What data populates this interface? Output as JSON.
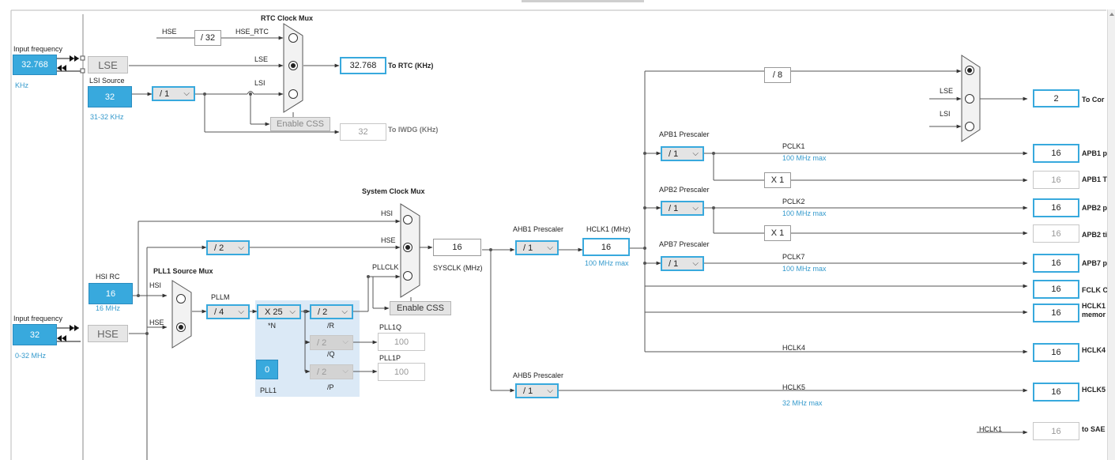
{
  "rtc": {
    "mux_title": "RTC Clock Mux",
    "input_freq_label": "Input frequency",
    "lse_freq": "32.768",
    "khz_unit": "KHz",
    "lse_label": "LSE",
    "lsi_source_label": "LSI Source",
    "lsi_value": "32",
    "lsi_range": "31-32 KHz",
    "lsi_div": "/ 1",
    "hse_label": "HSE",
    "hse_div": "/ 32",
    "hse_rtc_label": "HSE_RTC",
    "mux_lse": "LSE",
    "mux_lsi": "LSI",
    "rtc_out": "32.768",
    "rtc_out_label": "To RTC (KHz)",
    "enable_css": "Enable CSS",
    "iwdg_out": "32",
    "iwdg_label": "To IWDG (KHz)"
  },
  "hse_in": {
    "input_freq_label": "Input frequency",
    "value": "32",
    "range": "0-32 MHz",
    "box_label": "HSE"
  },
  "hsi": {
    "label": "HSI RC",
    "value": "16",
    "unit": "16 MHz"
  },
  "pll": {
    "mux_title": "PLL1 Source Mux",
    "hsi_label": "HSI",
    "hse_label": "HSE",
    "pllm_label": "PLLM",
    "pllm_value": "/ 4",
    "n_value": "X 25",
    "n_label": "*N",
    "r_value": "/ 2",
    "r_label": "/R",
    "q_value": "/ 2",
    "q_label": "/Q",
    "p_value": "/ 2",
    "p_label": "/P",
    "pll1q_label": "PLL1Q",
    "pll1q_value": "100",
    "pll1p_label": "PLL1P",
    "pll1p_value": "100",
    "pll1_label": "PLL1",
    "pll1_frac": "0"
  },
  "sysclk": {
    "mux_title": "System Clock Mux",
    "hsi_label": "HSI",
    "hse_label": "HSE",
    "pllclk_label": "PLLCLK",
    "hse_div": "/ 2",
    "value": "16",
    "label": "SYSCLK (MHz)",
    "enable_css": "Enable CSS"
  },
  "ahb": {
    "ahb1_label": "AHB1 Prescaler",
    "ahb1_value": "/ 1",
    "hclk1_label": "HCLK1 (MHz)",
    "hclk1_value": "16",
    "hclk1_max": "100 MHz max",
    "ahb5_label": "AHB5 Prescaler",
    "ahb5_value": "/ 1"
  },
  "bus": {
    "div8": "/ 8",
    "mux_lse": "LSE",
    "mux_lsi": "LSI",
    "cortex_value": "2",
    "cortex_label": "To Cor",
    "apb1_label": "APB1 Prescaler",
    "apb1_value": "/ 1",
    "pclk1_label": "PCLK1",
    "pclk1_max": "100 MHz max",
    "apb1_out": "16",
    "apb1_out_label": "APB1 p",
    "x1_a": "X 1",
    "apb1_tim": "16",
    "apb1_tim_label": "APB1 Ti",
    "apb2_label": "APB2 Prescaler",
    "apb2_value": "/ 1",
    "pclk2_label": "PCLK2",
    "pclk2_max": "100 MHz max",
    "apb2_out": "16",
    "apb2_out_label": "APB2 p",
    "x1_b": "X 1",
    "apb2_tim": "16",
    "apb2_tim_label": "APB2 ti",
    "apb7_label": "APB7 Prescaler",
    "apb7_value": "/ 1",
    "pclk7_label": "PCLK7",
    "pclk7_max": "100 MHz max",
    "apb7_out": "16",
    "apb7_out_label": "APB7 p",
    "fclk_value": "16",
    "fclk_label": "FCLK C",
    "hclk1_mem_value": "16",
    "hclk1_mem_label1": "HCLK1",
    "hclk1_mem_label2": "memor",
    "hclk4_line": "HCLK4",
    "hclk4_value": "16",
    "hclk4_label": "HCLK4",
    "hclk5_line": "HCLK5",
    "hclk5_max": "32 MHz max",
    "hclk5_value": "16",
    "hclk5_label": "HCLK5",
    "hclk1_sae_line": "HCLK1",
    "sae_value": "16",
    "sae_label": "to SAE"
  }
}
